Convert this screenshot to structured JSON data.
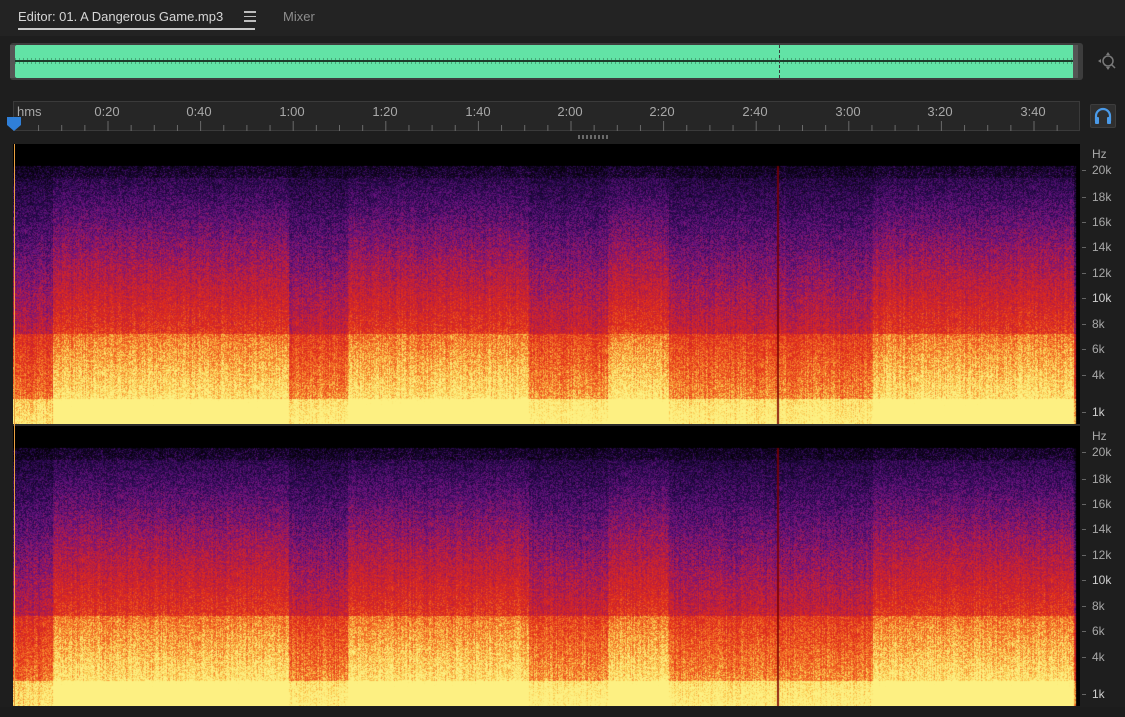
{
  "tabs": {
    "editor_label": "Editor: 01. A Dangerous Game.mp3",
    "mixer_label": "Mixer",
    "menu_icon": "hamburger-icon"
  },
  "overview": {
    "zoom_icon": "zoom-icon"
  },
  "ruler": {
    "unit": "hms",
    "labels": [
      "0:20",
      "0:40",
      "1:00",
      "1:20",
      "1:40",
      "2:00",
      "2:20",
      "2:40",
      "3:00",
      "3:20",
      "3:40"
    ]
  },
  "monitor_button": {
    "icon": "headphones-icon"
  },
  "spectral": {
    "unit": "Hz",
    "labels": [
      "20k",
      "18k",
      "16k",
      "14k",
      "12k",
      "10k",
      "8k",
      "6k",
      "4k",
      "1k"
    ],
    "highlighted": [
      "10k",
      "1k"
    ]
  },
  "colors": {
    "waveform": "#62e3a6",
    "spectral_high": "#fdf07a",
    "spectral_mid": "#e02a1a",
    "spectral_low": "#4a1a7a",
    "playhead": "#2f7fd8"
  }
}
